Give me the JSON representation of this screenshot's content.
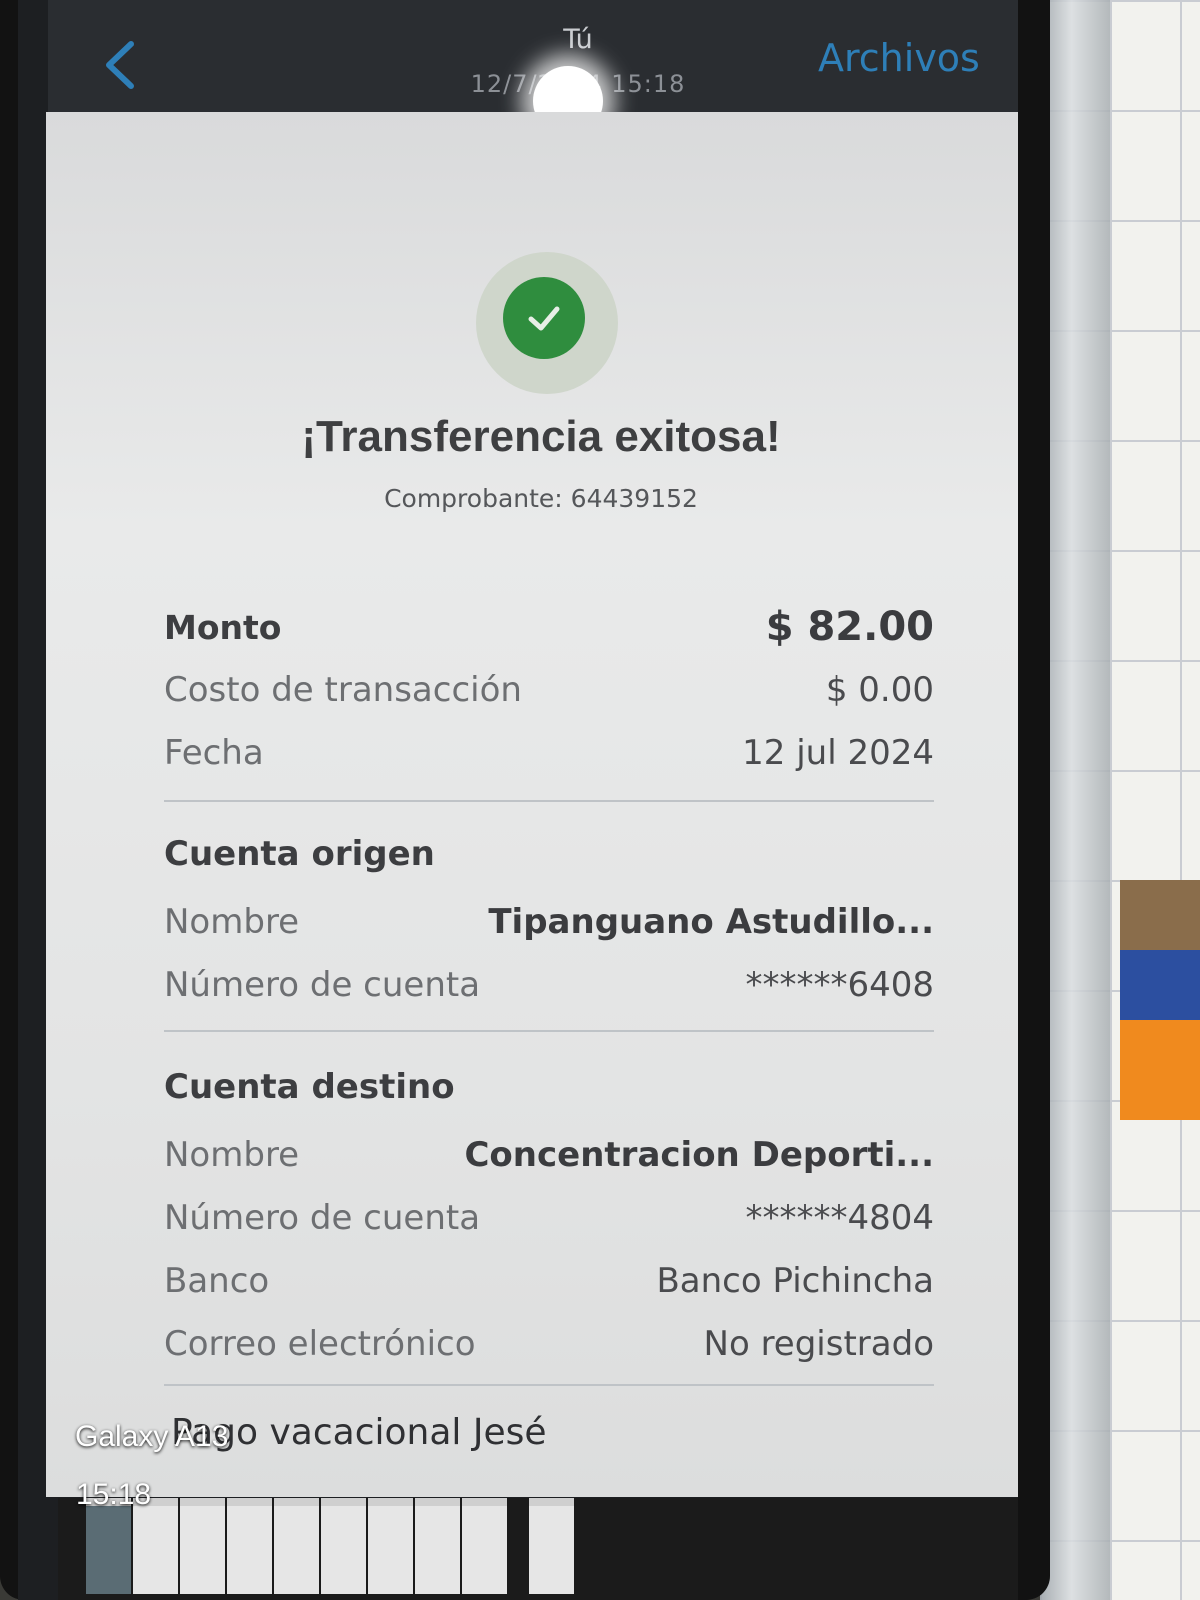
{
  "header": {
    "sender": "Tú",
    "date": "12/7/2024 15:18",
    "files_label": "Archivos"
  },
  "receipt": {
    "title": "¡Transferencia exitosa!",
    "voucher": "Comprobante: 64439152",
    "summary": {
      "amount_label": "Monto",
      "amount_value": "$ 82.00",
      "fee_label": "Costo de transacción",
      "fee_value": "$ 0.00",
      "date_label": "Fecha",
      "date_value": "12 jul 2024"
    },
    "origin": {
      "title": "Cuenta origen",
      "name_label": "Nombre",
      "name_value": "Tipanguano  Astudillo...",
      "account_label": "Número de cuenta",
      "account_value": "******6408"
    },
    "destination": {
      "title": "Cuenta destino",
      "name_label": "Nombre",
      "name_value": "Concentracion Deporti...",
      "account_label": "Número de cuenta",
      "account_value": "******4804",
      "bank_label": "Banco",
      "bank_value": "Banco Pichincha",
      "email_label": "Correo electrónico",
      "email_value": "No registrado"
    }
  },
  "caption": "Pago vacacional Jesé",
  "camera_watermark": {
    "model": "Galaxy A13",
    "time": "15:18"
  },
  "colors": {
    "success_green": "#2f8d3e",
    "link_blue": "#2e7fb8"
  }
}
